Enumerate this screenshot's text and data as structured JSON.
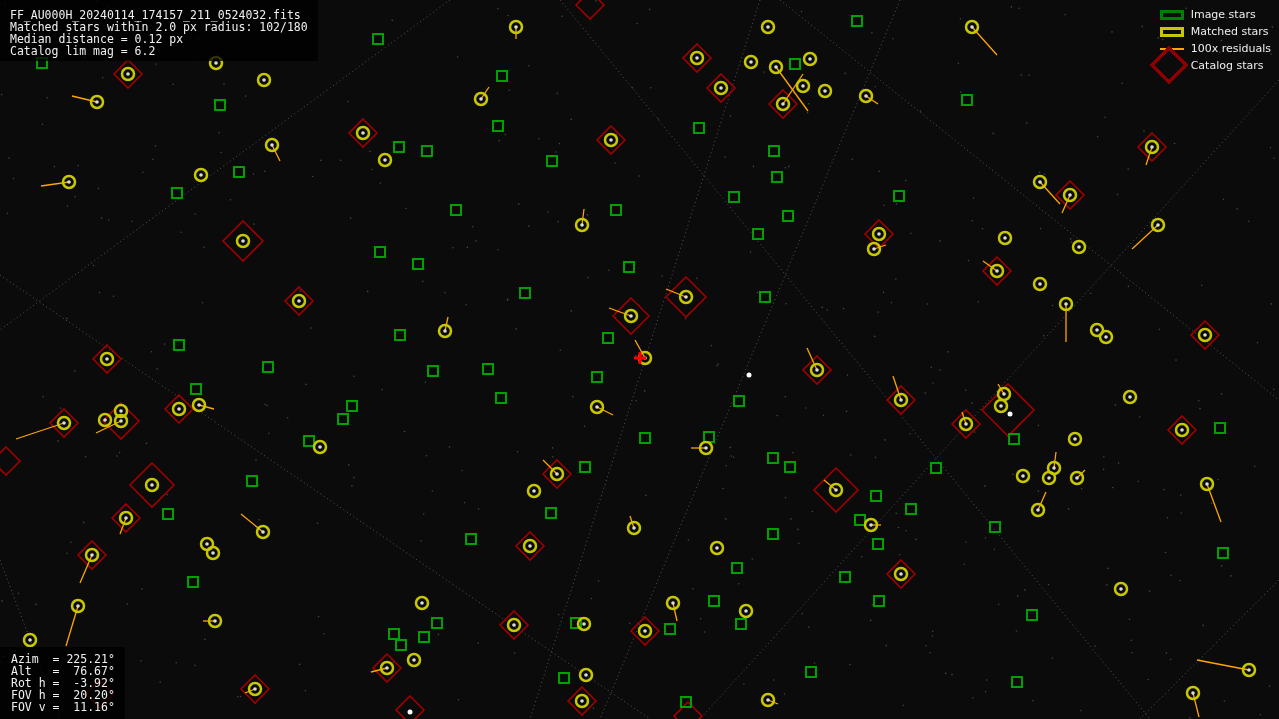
{
  "header": {
    "lines": [
      "FF_AU000H_20240114_174157_211_0524032.fits",
      "Matched stars within 2.0 px radius: 102/180",
      "Median distance = 0.12 px",
      "Catalog lim mag = 6.2"
    ]
  },
  "legend": [
    {
      "label": "Image stars",
      "kind": "box",
      "color": "#008000"
    },
    {
      "label": "Matched stars",
      "kind": "box",
      "color": "#c8c800"
    },
    {
      "label": "100x residuals",
      "kind": "line",
      "color": "#ffa500"
    },
    {
      "label": "Catalog stars",
      "kind": "diamond",
      "color": "#8b0000"
    }
  ],
  "pointing": {
    "lines": [
      "Azim  = 225.21°",
      "Alt   =  76.67°",
      "Rot h =  -3.92°",
      "FOV h =  20.20°",
      "FOV v =  11.16°"
    ]
  }
}
